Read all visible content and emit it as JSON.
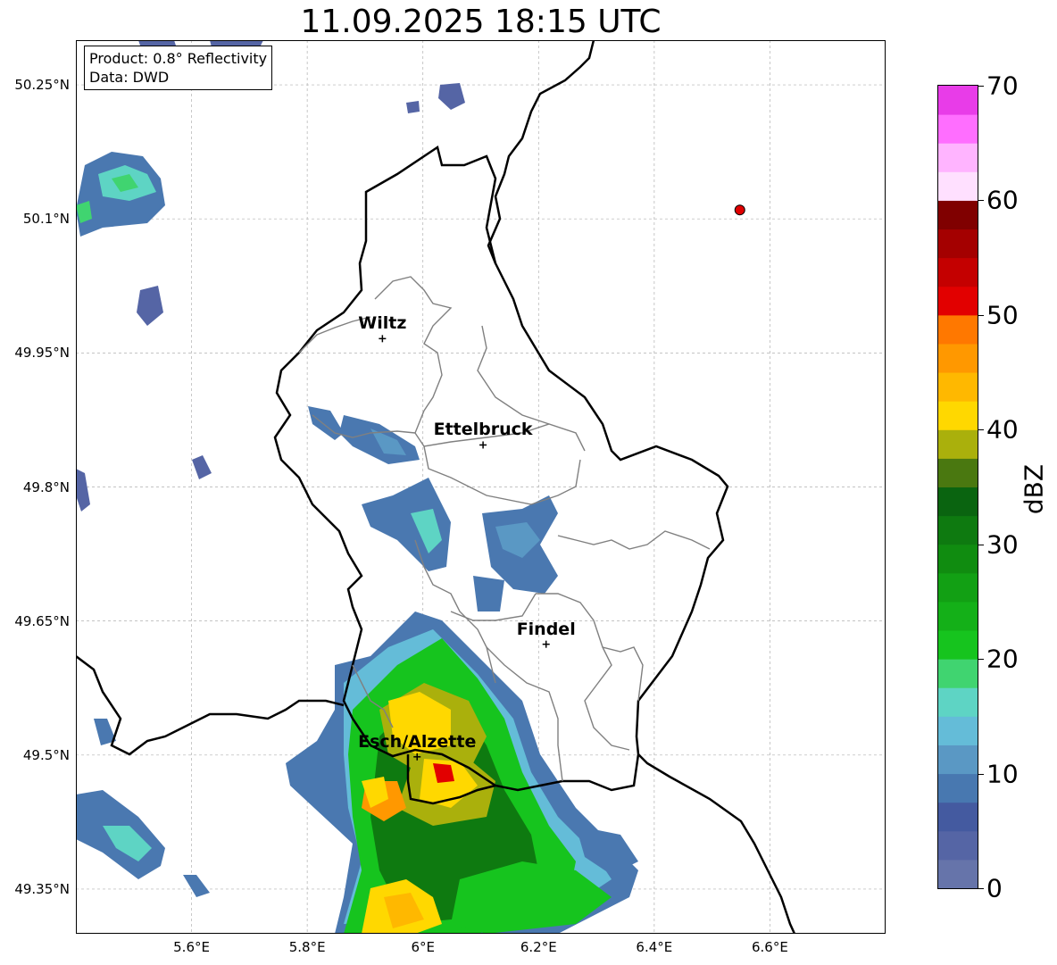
{
  "title": "11.09.2025 18:15 UTC",
  "info_box": {
    "line1": "Product: 0.8° Reflectivity",
    "line2": "Data: DWD"
  },
  "map": {
    "lon_range": [
      5.4,
      6.8
    ],
    "lat_range": [
      49.3,
      50.3
    ],
    "lat_ticks": [
      {
        "value": 50.25,
        "label": "50.25°N"
      },
      {
        "value": 50.1,
        "label": "50.1°N"
      },
      {
        "value": 49.95,
        "label": "49.95°N"
      },
      {
        "value": 49.8,
        "label": "49.8°N"
      },
      {
        "value": 49.65,
        "label": "49.65°N"
      },
      {
        "value": 49.5,
        "label": "49.5°N"
      },
      {
        "value": 49.35,
        "label": "49.35°N"
      }
    ],
    "lon_ticks": [
      {
        "value": 5.6,
        "label": "5.6°E"
      },
      {
        "value": 5.8,
        "label": "5.8°E"
      },
      {
        "value": 6.0,
        "label": "6°E"
      },
      {
        "value": 6.2,
        "label": "6.2°E"
      },
      {
        "value": 6.4,
        "label": "6.4°E"
      },
      {
        "value": 6.6,
        "label": "6.6°E"
      }
    ],
    "grid": true,
    "cities": [
      {
        "name": "Wiltz",
        "lon": 5.93,
        "lat": 49.966
      },
      {
        "name": "Ettelbruck",
        "lon": 6.104,
        "lat": 49.847
      },
      {
        "name": "Findel",
        "lon": 6.213,
        "lat": 49.624
      },
      {
        "name": "Esch/Alzette",
        "lon": 5.99,
        "lat": 49.498
      }
    ],
    "radar_site": {
      "lon": 6.548,
      "lat": 50.11,
      "color": "#e00000"
    }
  },
  "colorbar": {
    "label": "dBZ",
    "min": 0,
    "max": 70,
    "step": 2.5,
    "colors": [
      "#6674aa",
      "#5565a5",
      "#445aa0",
      "#4878b0",
      "#5a98c4",
      "#64bcd8",
      "#5ed4c4",
      "#40d470",
      "#16c41e",
      "#14b018",
      "#12a014",
      "#108c10",
      "#0e7a10",
      "#0a6410",
      "#4a7810",
      "#aab00c",
      "#ffd800",
      "#ffb800",
      "#ff9800",
      "#ff7800",
      "#e20000",
      "#c40000",
      "#a40000",
      "#800000",
      "#ffe0ff",
      "#ffb4ff",
      "#ff6eff",
      "#e83ce8"
    ],
    "ticks": [
      {
        "value": 0,
        "label": "0"
      },
      {
        "value": 10,
        "label": "10"
      },
      {
        "value": 20,
        "label": "20"
      },
      {
        "value": 30,
        "label": "30"
      },
      {
        "value": 40,
        "label": "40"
      },
      {
        "value": 50,
        "label": "50"
      },
      {
        "value": 60,
        "label": "60"
      },
      {
        "value": 70,
        "label": "70"
      }
    ]
  }
}
